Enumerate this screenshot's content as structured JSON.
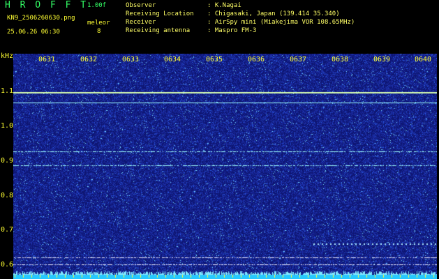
{
  "header": {
    "program": "H R O F F T",
    "version": "1.00f",
    "filename": "KN9_2506260630.png",
    "mode": "meleor",
    "datetime": "25.06.26 06:30",
    "count": "8",
    "rows": [
      {
        "label": "Observer",
        "value": ": K.Nagai"
      },
      {
        "label": "Receiving Location",
        "value": ": Chigasaki, Japan (139.414 35.340)"
      },
      {
        "label": "Receiver",
        "value": ": AirSpy mini (Miakejima VOR 108.65MHz)"
      },
      {
        "label": "Receiving antenna",
        "value": ": Maspro FM-3"
      }
    ]
  },
  "chart_data": {
    "type": "heatmap",
    "ylabel": "kHz",
    "y_ticks": [
      "1.1",
      "1.0",
      "0.9",
      "0.8",
      "0.7",
      "0.6"
    ],
    "x_ticks": [
      "0631",
      "0632",
      "0633",
      "0634",
      "0635",
      "0636",
      "0637",
      "0638",
      "0639",
      "0640"
    ],
    "ylim": [
      0.58,
      1.2
    ],
    "xlim": [
      "06:30",
      "06:40"
    ],
    "traces_khz": [
      1.095,
      1.065,
      0.925,
      0.885,
      0.62,
      0.6
    ],
    "colors": {
      "background": "#000000",
      "labels": "#ffff33",
      "noise": "#1e2fa0",
      "trace": "#9fffff"
    }
  }
}
